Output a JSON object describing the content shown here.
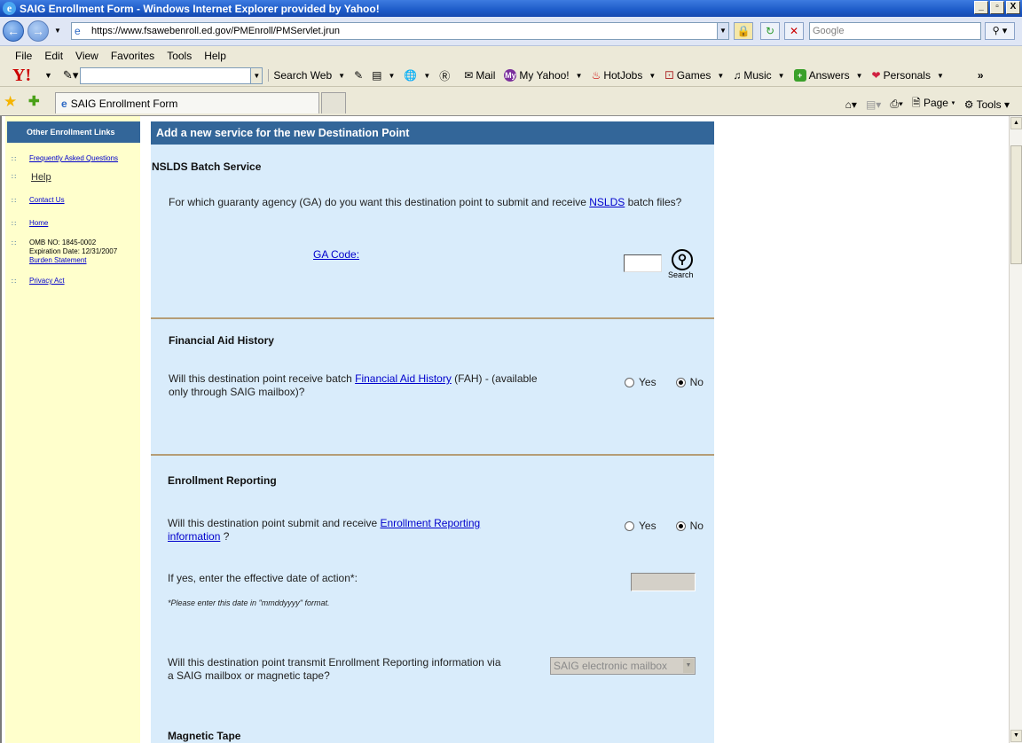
{
  "window": {
    "title": "SAIG Enrollment Form - Windows Internet Explorer provided by Yahoo!",
    "buttons": [
      "_",
      "▫",
      "X"
    ]
  },
  "addressbar": {
    "url": "https://www.fsawebenroll.ed.gov/PMEnroll/PMServlet.jrun",
    "search_placeholder": "Google"
  },
  "menu": [
    "File",
    "Edit",
    "View",
    "Favorites",
    "Tools",
    "Help"
  ],
  "yahoo_toolbar": {
    "search_web": "Search Web",
    "items": [
      "Mail",
      "My Yahoo!",
      "HotJobs",
      "Games",
      "Music",
      "Answers",
      "Personals"
    ]
  },
  "tabs": {
    "active_tab": "SAIG Enrollment Form",
    "commands": [
      "Page",
      "Tools"
    ]
  },
  "sidebar": {
    "header": "Other Enrollment Links",
    "faq": "Frequently Asked Questions",
    "help": "Help",
    "contact": "Contact Us",
    "home": "Home",
    "omb": "OMB NO: 1845-0002",
    "expiration": "Expiration Date:  12/31/2007",
    "burden": "Burden Statement",
    "privacy": "Privacy Act"
  },
  "form": {
    "header": "Add a new service for the new Destination Point",
    "nslds": {
      "title": "NSLDS Batch Service",
      "question_pre": "For which guaranty agency (GA) do you want this destination point to submit and receive ",
      "question_link": "NSLDS",
      "question_post": " batch files?",
      "ga_code_label": "GA Code:",
      "search_label": "Search"
    },
    "fah": {
      "title": "Financial Aid History",
      "question_pre": "Will this destination point receive batch ",
      "question_link": "Financial Aid History",
      "question_post1": " (FAH) - (available",
      "question_post2": "only through SAIG mailbox)?",
      "yes": "Yes",
      "no": "No",
      "selected": "No"
    },
    "er": {
      "title": "Enrollment Reporting",
      "question_pre": "Will this destination point submit and receive ",
      "question_link1": "Enrollment Reporting",
      "question_link2": "information",
      "question_post": " ?",
      "yes": "Yes",
      "no": "No",
      "selected": "No",
      "date_label": "If yes, enter the effective date of action*:",
      "date_hint": "*Please enter this date in \"mmddyyyy\" format.",
      "transmit_q1": "Will this destination point transmit Enrollment Reporting information via",
      "transmit_q2": "a SAIG mailbox or magnetic tape?",
      "transmit_value": "SAIG electronic mailbox"
    },
    "next_section": "Magnetic Tape"
  }
}
